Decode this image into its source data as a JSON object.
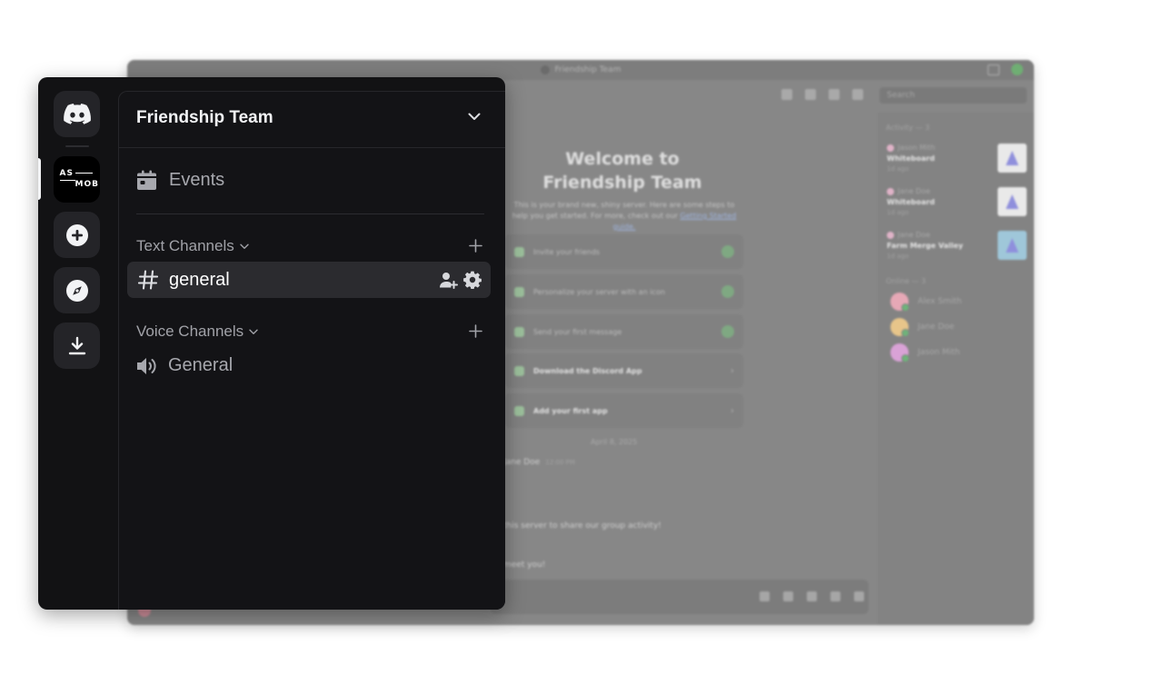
{
  "background_window": {
    "title": "Friendship Team",
    "search_placeholder": "Search",
    "welcome_title": "Welcome to Friendship Team",
    "welcome_subtitle": "This is your brand new, shiny server. Here are some steps to help you get started. For more, check out our",
    "welcome_link": "Getting Started guide.",
    "checklist": [
      {
        "label": "Invite your friends",
        "done": true
      },
      {
        "label": "Personalize your server with an icon",
        "done": true
      },
      {
        "label": "Send your first message",
        "done": true
      },
      {
        "label": "Download the Discord App",
        "done": false
      },
      {
        "label": "Add your first app",
        "done": false
      }
    ],
    "date_divider": "April 8, 2025",
    "message_author": "Jane Doe",
    "message_time": "12:00 PM",
    "message_line1": "this server to share our group activity!",
    "message_line2": "meet you!",
    "activity_header": "Activity — 3",
    "activities": [
      {
        "user": "Jason Mith",
        "name": "Whiteboard",
        "time": "1d ago"
      },
      {
        "user": "Jane Doe",
        "name": "Whiteboard",
        "time": "1d ago"
      },
      {
        "user": "Jane Doe",
        "name": "Farm Merge Valley",
        "time": "1d ago"
      }
    ],
    "online_header": "Online — 3",
    "members": [
      "Alex Smith",
      "Jane Doe",
      "Jason Mith"
    ]
  },
  "guild_rail": {
    "home_icon": "discord-logo-icon",
    "server_abbrev_line1": "AS",
    "server_abbrev_line2": "MOB",
    "add_server_icon": "plus-circle-icon",
    "discover_icon": "compass-icon",
    "download_icon": "download-icon"
  },
  "channel_list": {
    "server_name": "Friendship Team",
    "events_label": "Events",
    "text_category": "Text Channels",
    "text_channels": [
      {
        "name": "general",
        "selected": true
      }
    ],
    "voice_category": "Voice Channels",
    "voice_channels": [
      {
        "name": "General"
      }
    ]
  },
  "colors": {
    "panel_bg": "#121214",
    "selected_channel_bg": "#2b2b2f",
    "muted_text": "#a7a8ae",
    "overlay_gray": "#878787"
  }
}
